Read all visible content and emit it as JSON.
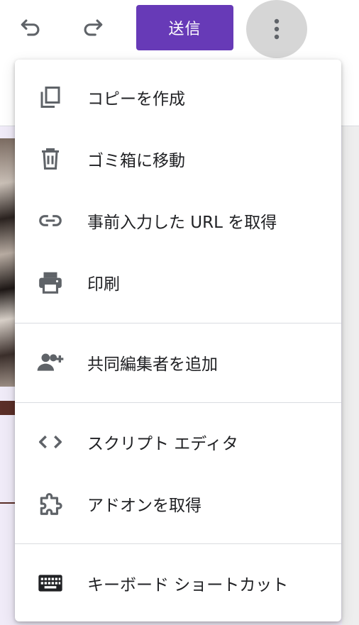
{
  "toolbar": {
    "undo_icon": "undo-icon",
    "redo_icon": "redo-icon",
    "send_label": "送信",
    "more_icon": "more-vert-icon",
    "accent_color": "#673ab7"
  },
  "menu": {
    "items": [
      {
        "label": "コピーを作成",
        "icon": "copy-icon"
      },
      {
        "label": "ゴミ箱に移動",
        "icon": "trash-icon"
      },
      {
        "label": "事前入力した URL を取得",
        "icon": "link-icon"
      },
      {
        "label": "印刷",
        "icon": "print-icon"
      },
      {
        "label": "共同編集者を追加",
        "icon": "add-people-icon"
      },
      {
        "label": "スクリプト エディタ",
        "icon": "code-icon"
      },
      {
        "label": "アドオンを取得",
        "icon": "puzzle-icon"
      },
      {
        "label": "キーボード ショートカット",
        "icon": "keyboard-icon"
      }
    ]
  }
}
